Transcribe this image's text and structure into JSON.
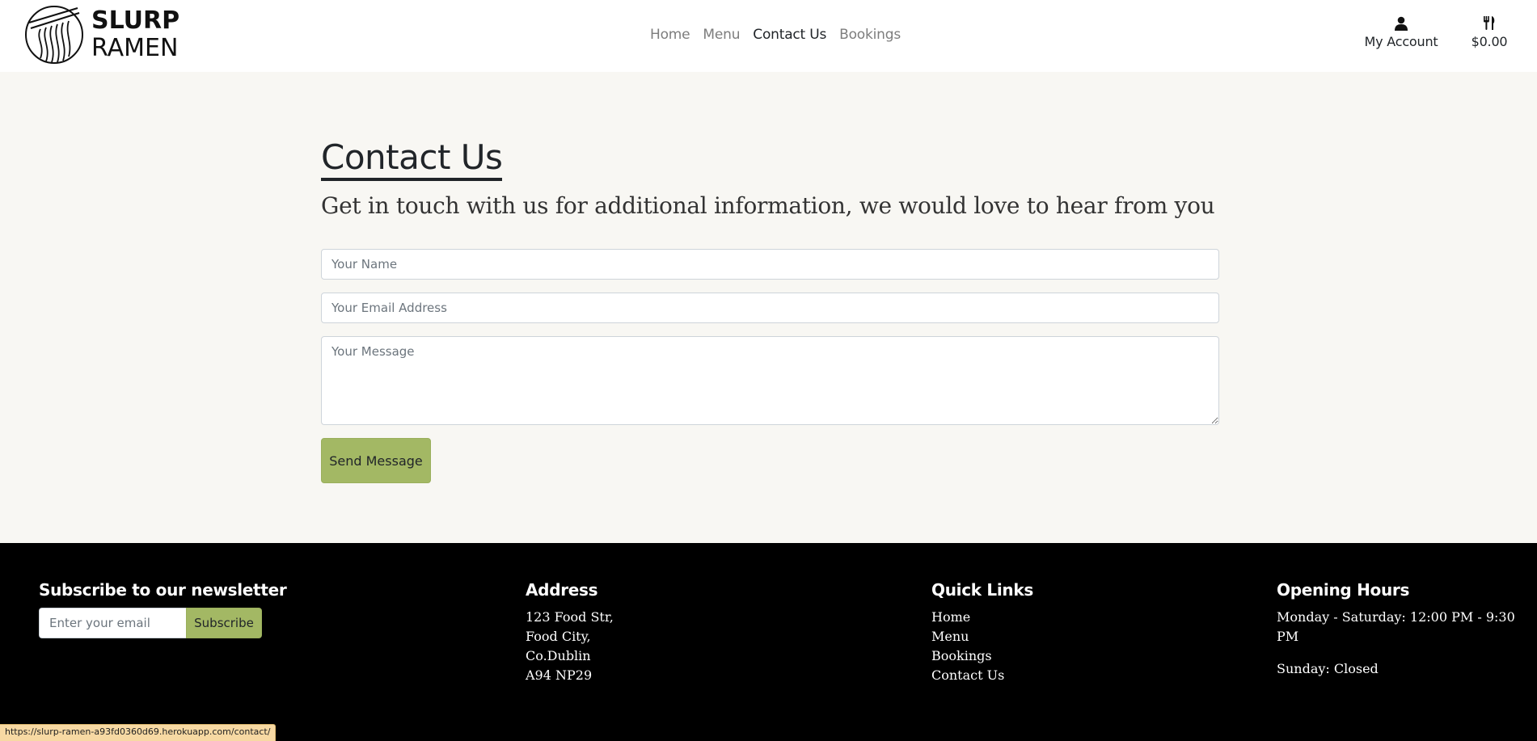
{
  "brand": {
    "line1": "SLURP",
    "line2": "RAMEN"
  },
  "nav": {
    "items": [
      {
        "label": "Home",
        "active": false
      },
      {
        "label": "Menu",
        "active": false
      },
      {
        "label": "Contact Us",
        "active": true
      },
      {
        "label": "Bookings",
        "active": false
      }
    ],
    "account_label": "My Account",
    "account_icon": "user-icon",
    "cart_total": "$0.00",
    "cart_icon": "utensils-icon"
  },
  "main": {
    "title": "Contact Us",
    "subtitle": "Get in touch with us for additional information, we would love to hear from you",
    "form": {
      "name_placeholder": "Your Name",
      "email_placeholder": "Your Email Address",
      "message_placeholder": "Your Message",
      "submit_label": "Send Message"
    }
  },
  "footer": {
    "newsletter": {
      "heading": "Subscribe to our newsletter",
      "placeholder": "Enter your email",
      "button_label": "Subscribe"
    },
    "address": {
      "heading": "Address",
      "lines": [
        "123 Food Str,",
        "Food City,",
        "Co.Dublin",
        "A94 NP29"
      ]
    },
    "quick_links": {
      "heading": "Quick Links",
      "links": [
        "Home",
        "Menu",
        "Bookings",
        "Contact Us"
      ]
    },
    "opening_hours": {
      "heading": "Opening Hours",
      "weekdays": "Monday - Saturday: 12:00 PM - 9:30 PM",
      "sunday": "Sunday: Closed"
    }
  },
  "status_url": "https://slurp-ramen-a93fd0360d69.herokuapp.com/contact/",
  "colors": {
    "accent": "#a3b864",
    "page_bg": "#f8f7f3",
    "footer_bg": "#000000",
    "status_bar_bg": "#f7d9a3"
  }
}
